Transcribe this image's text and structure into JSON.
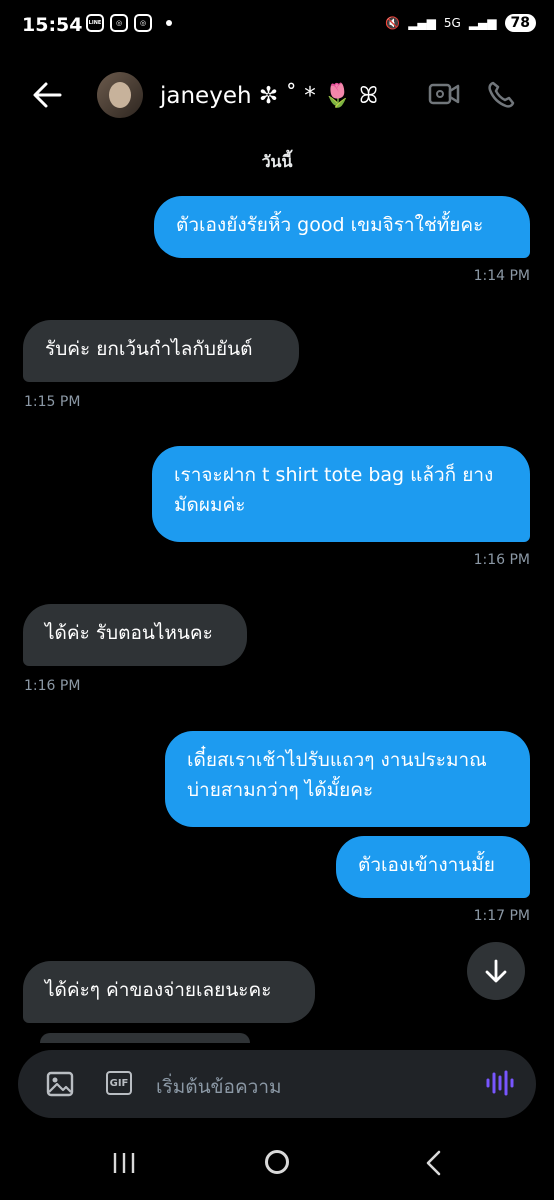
{
  "status": {
    "time": "15:54",
    "left_icons": [
      "LINE",
      "instagram-icon",
      "instagram-icon"
    ],
    "network": "5G",
    "battery": "78"
  },
  "header": {
    "contact_name": "janeyeh ✼ ˚ * 🌷 ꕤ",
    "icons": [
      "back-arrow-icon",
      "video-call-icon",
      "phone-icon"
    ]
  },
  "chat": {
    "day_label": "วันนี้",
    "messages": [
      {
        "direction": "out",
        "text": "ตัวเองยังรัยหิ้ว good เขมจิราใช่ทั้ยคะ",
        "time": "1:14 PM"
      },
      {
        "direction": "in",
        "text": "รับค่ะ ยกเว้นกำไลกับยันต์",
        "time": "1:15 PM"
      },
      {
        "direction": "out",
        "text": "เราจะฝาก t shirt  tote bag แล้วก็ ยางมัดผมค่ะ",
        "time": "1:16 PM"
      },
      {
        "direction": "in",
        "text": "ได้ค่ะ รับตอนไหนคะ",
        "time": "1:16 PM"
      },
      {
        "direction": "out",
        "text": "เดี๋ยสเราเช้าไปรับแถวๆ งานประมาณบ่ายสามกว่าๆ ได้มั้ยคะ",
        "time": ""
      },
      {
        "direction": "out",
        "text": "ตัวเองเข้างานมั้ย",
        "time": "1:17 PM"
      },
      {
        "direction": "in",
        "text": "ได้ค่ะๆ ค่าของจ่ายเลยนะคะ",
        "time": ""
      }
    ]
  },
  "composer": {
    "placeholder": "เริ่มต้นข้อความ",
    "gif_label": "GIF"
  },
  "colors": {
    "outgoing_bubble": "#1d9bf0",
    "incoming_bubble": "#2f3336",
    "background": "#000000",
    "voice_accent": "#7856ff"
  }
}
